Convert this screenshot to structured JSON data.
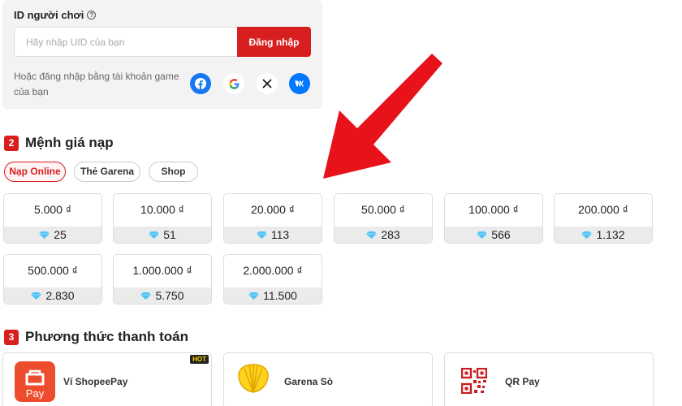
{
  "login": {
    "title": "ID người chơi",
    "help_icon": "question-circle-icon",
    "uid_placeholder": "Hãy nhập UID của bạn",
    "uid_value": "",
    "login_button": "Đăng nhập",
    "alt_text": "Hoặc đăng nhập bằng tài khoản game của bạn",
    "social": [
      {
        "name": "facebook-icon",
        "color": "#1877f2"
      },
      {
        "name": "google-icon",
        "color": "#ffffff"
      },
      {
        "name": "x-icon",
        "color": "#ffffff"
      },
      {
        "name": "vk-icon",
        "color": "#0077ff"
      }
    ]
  },
  "denominations": {
    "number": "2",
    "title": "Mệnh giá nạp",
    "filters": [
      {
        "label": "Nạp Online",
        "active": true
      },
      {
        "label": "Thẻ Garena",
        "active": false
      },
      {
        "label": "Shop",
        "active": false
      }
    ],
    "items": [
      {
        "price": "5.000 ₫",
        "gems": "25"
      },
      {
        "price": "10.000 ₫",
        "gems": "51"
      },
      {
        "price": "20.000 ₫",
        "gems": "113"
      },
      {
        "price": "50.000 ₫",
        "gems": "283"
      },
      {
        "price": "100.000 ₫",
        "gems": "566"
      },
      {
        "price": "200.000 ₫",
        "gems": "1.132"
      },
      {
        "price": "500.000 ₫",
        "gems": "2.830"
      },
      {
        "price": "1.000.000 ₫",
        "gems": "5.750"
      },
      {
        "price": "2.000.000 ₫",
        "gems": "11.500"
      }
    ]
  },
  "payment": {
    "number": "3",
    "title": "Phương thức thanh toán",
    "methods": [
      {
        "label": "Ví ShopeePay",
        "badge": "HOT",
        "icon": "shopeepay-logo-icon"
      },
      {
        "label": "Garena Sò",
        "badge": "",
        "icon": "shell-icon"
      },
      {
        "label": "QR Pay",
        "badge": "",
        "icon": "qr-code-icon"
      }
    ]
  },
  "colors": {
    "accent": "#d71f1f",
    "gem": "#4fc3f7",
    "arrow": "#e8121a"
  }
}
